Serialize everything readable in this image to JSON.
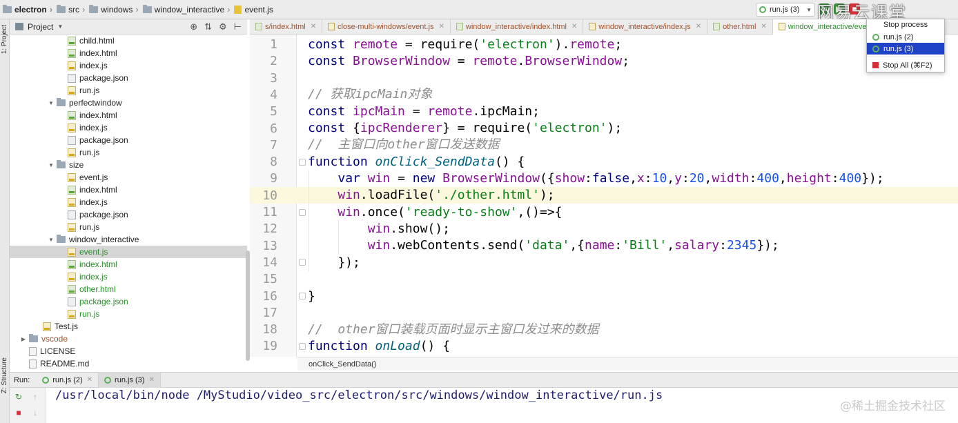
{
  "breadcrumb": [
    {
      "label": "electron",
      "icon": "folder-icon"
    },
    {
      "label": "src",
      "icon": "folder-icon"
    },
    {
      "label": "windows",
      "icon": "folder-icon"
    },
    {
      "label": "window_interactive",
      "icon": "folder-icon"
    },
    {
      "label": "event.js",
      "icon": "js-file-icon"
    }
  ],
  "run_config": {
    "selected": "run.js (3)"
  },
  "watermark_top": "网易云课堂",
  "vertical_strip": {
    "project_label": "1: Project",
    "structure_label": "Z: Structure"
  },
  "project_panel": {
    "title": "Project"
  },
  "tree": [
    {
      "label": "child.html",
      "type": "html",
      "color": "default",
      "indent": 3
    },
    {
      "label": "index.html",
      "type": "html",
      "color": "default",
      "indent": 3
    },
    {
      "label": "index.js",
      "type": "js",
      "color": "default",
      "indent": 3
    },
    {
      "label": "package.json",
      "type": "json",
      "color": "default",
      "indent": 3
    },
    {
      "label": "run.js",
      "type": "js",
      "color": "default",
      "indent": 3
    },
    {
      "label": "perfectwindow",
      "type": "folder",
      "color": "default",
      "indent": 2
    },
    {
      "label": "index.html",
      "type": "html",
      "color": "default",
      "indent": 3
    },
    {
      "label": "index.js",
      "type": "js",
      "color": "default",
      "indent": 3
    },
    {
      "label": "package.json",
      "type": "json",
      "color": "default",
      "indent": 3
    },
    {
      "label": "run.js",
      "type": "js",
      "color": "default",
      "indent": 3
    },
    {
      "label": "size",
      "type": "folder",
      "color": "default",
      "indent": 2
    },
    {
      "label": "event.js",
      "type": "js",
      "color": "default",
      "indent": 3
    },
    {
      "label": "index.html",
      "type": "html",
      "color": "default",
      "indent": 3
    },
    {
      "label": "index.js",
      "type": "js",
      "color": "default",
      "indent": 3
    },
    {
      "label": "package.json",
      "type": "json",
      "color": "default",
      "indent": 3
    },
    {
      "label": "run.js",
      "type": "js",
      "color": "default",
      "indent": 3
    },
    {
      "label": "window_interactive",
      "type": "folder",
      "color": "default",
      "indent": 2
    },
    {
      "label": "event.js",
      "type": "js",
      "color": "green",
      "indent": 3,
      "selected": true
    },
    {
      "label": "index.html",
      "type": "html",
      "color": "green",
      "indent": 3
    },
    {
      "label": "index.js",
      "type": "js",
      "color": "green",
      "indent": 3
    },
    {
      "label": "other.html",
      "type": "html",
      "color": "green",
      "indent": 3
    },
    {
      "label": "package.json",
      "type": "json",
      "color": "green",
      "indent": 3
    },
    {
      "label": "run.js",
      "type": "js",
      "color": "green",
      "indent": 3
    },
    {
      "label": "Test.js",
      "type": "js",
      "color": "default",
      "indent": 1
    },
    {
      "label": "vscode",
      "type": "folder",
      "color": "brown",
      "indent": 0,
      "collapsed": true
    },
    {
      "label": "LICENSE",
      "type": "file",
      "color": "default",
      "indent": 0
    },
    {
      "label": "README.md",
      "type": "file",
      "color": "default",
      "indent": 0
    }
  ],
  "tabs": [
    {
      "label": "s/index.html",
      "kind": "html"
    },
    {
      "label": "close-multi-windows/event.js",
      "kind": "js"
    },
    {
      "label": "window_interactive/index.html",
      "kind": "html"
    },
    {
      "label": "window_interactive/index.js",
      "kind": "js"
    },
    {
      "label": "other.html",
      "kind": "html"
    },
    {
      "label": "window_interactive/event.js",
      "kind": "js",
      "active": true
    }
  ],
  "editor": {
    "line_numbers": [
      "1",
      "2",
      "3",
      "4",
      "5",
      "6",
      "7",
      "8",
      "9",
      "10",
      "11",
      "12",
      "13",
      "14",
      "15",
      "16",
      "17",
      "18",
      "19"
    ],
    "current_line": "10",
    "code_breadcrumb": "onClick_SendData()"
  },
  "popup": {
    "title": "Stop process",
    "items": [
      "run.js (2)",
      "run.js (3)"
    ],
    "stop_all": "Stop All (⌘F2)"
  },
  "run_panel": {
    "label": "Run:",
    "tabs": [
      "run.js (2)",
      "run.js (3)"
    ],
    "console_line": "/usr/local/bin/node /MyStudio/video_src/electron/src/windows/window_interactive/run.js"
  },
  "watermark_bottom": "@稀土掘金技术社区"
}
